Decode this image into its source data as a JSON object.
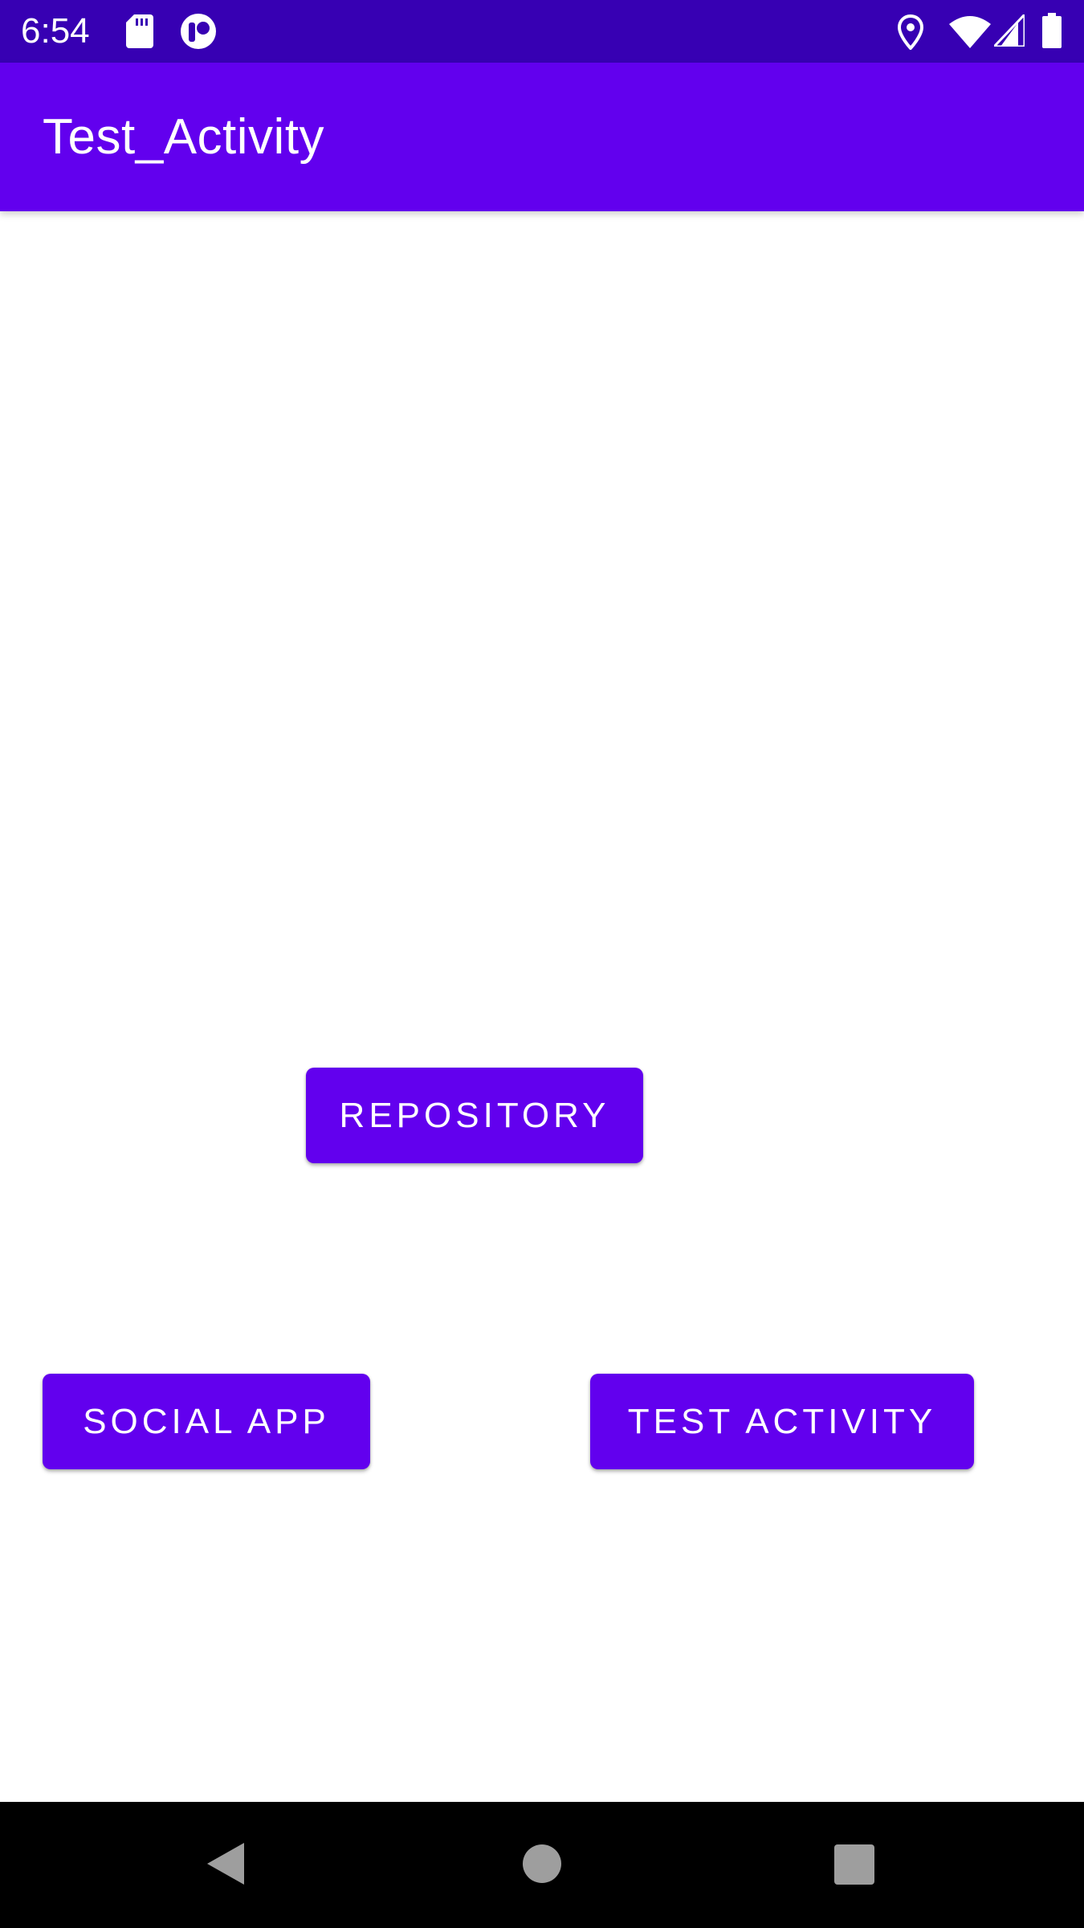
{
  "status_bar": {
    "time": "6:54",
    "icons": [
      "sd-card-icon",
      "app-notification-icon",
      "location-icon",
      "wifi-icon",
      "signal-icon",
      "battery-icon"
    ]
  },
  "app_bar": {
    "title": "Test_Activity"
  },
  "buttons": {
    "repository": "REPOSITORY",
    "social_app": "SOCIAL APP",
    "test_activity": "TEST ACTIVITY"
  },
  "nav_bar": {
    "icons": [
      "back-icon",
      "home-icon",
      "recents-icon"
    ]
  },
  "colors": {
    "status_bar": "#3700b3",
    "primary": "#6200ee",
    "background": "#ffffff",
    "nav_bar": "#000000"
  }
}
